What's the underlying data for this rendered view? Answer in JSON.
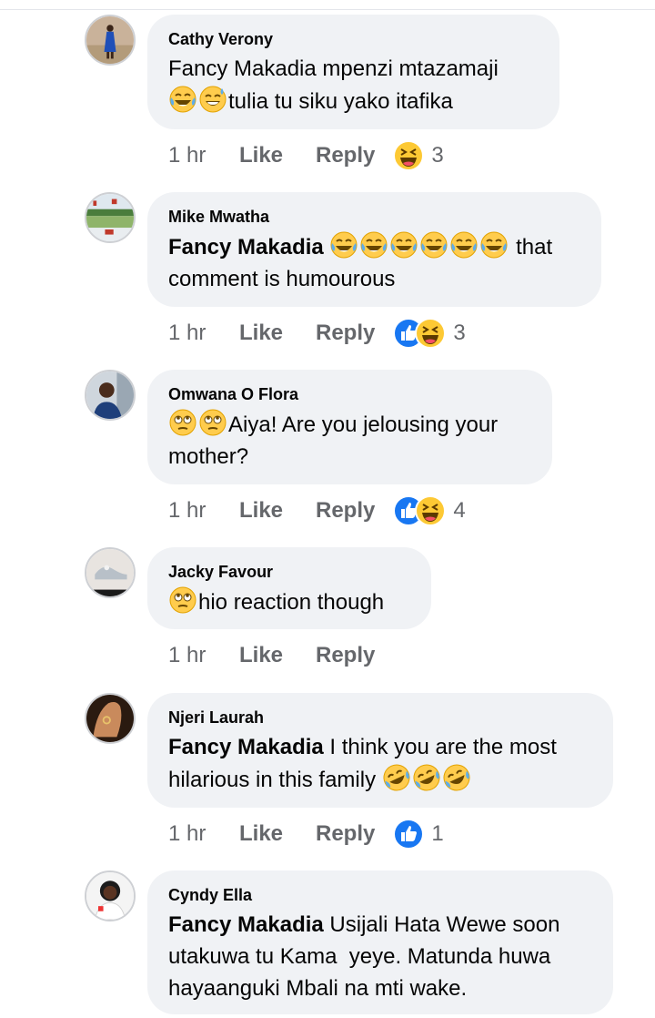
{
  "comments": [
    {
      "author": "Cathy Verony",
      "line1": "Fancy Makadia mpenzi mtazamaji",
      "line2_suffix": "tulia tu siku yako itafika",
      "time": "1 hr",
      "like": "Like",
      "reply": "Reply",
      "reaction_count": "3",
      "reactions": [
        "haha-reaction"
      ],
      "avatar": "person-in-blue-dress-avatar"
    },
    {
      "author": "Mike Mwatha",
      "tag": "Fancy Makadia",
      "line1_suffix": "that",
      "line2": "comment is humourous",
      "time": "1 hr",
      "like": "Like",
      "reply": "Reply",
      "reaction_count": "3",
      "reactions": [
        "like-reaction",
        "haha-reaction"
      ],
      "avatar": "landscape-avatar"
    },
    {
      "author": "Omwana O Flora",
      "line1_suffix": "Aiya! Are you jelousing your",
      "line2": "mother?",
      "time": "1 hr",
      "like": "Like",
      "reply": "Reply",
      "reaction_count": "4",
      "reactions": [
        "like-reaction",
        "haha-reaction"
      ],
      "avatar": "man-portrait-avatar"
    },
    {
      "author": "Jacky Favour",
      "line1_suffix": "hio reaction though",
      "time": "1 hr",
      "like": "Like",
      "reply": "Reply",
      "avatar": "shoe-photo-avatar"
    },
    {
      "author": "Njeri Laurah",
      "tag": "Fancy Makadia",
      "line1_suffix": "I think you are the most",
      "line2": "hilarious in this family",
      "time": "1 hr",
      "like": "Like",
      "reply": "Reply",
      "reaction_count": "1",
      "reactions": [
        "like-reaction"
      ],
      "avatar": "hand-with-ring-avatar"
    },
    {
      "author": "Cyndy Ella",
      "tag": "Fancy Makadia",
      "line1_suffix": "Usijali Hata Wewe soon",
      "line2": "utakuwa tu Kama  yeye. Matunda huwa",
      "line3": "hayaanguki Mbali na mti wake.",
      "avatar": "woman-portrait-avatar"
    }
  ],
  "colors": {
    "bubble": "#f0f2f5",
    "meta": "#65676b",
    "like_blue": "#1877f2",
    "haha_yellow": "#f7b125"
  }
}
